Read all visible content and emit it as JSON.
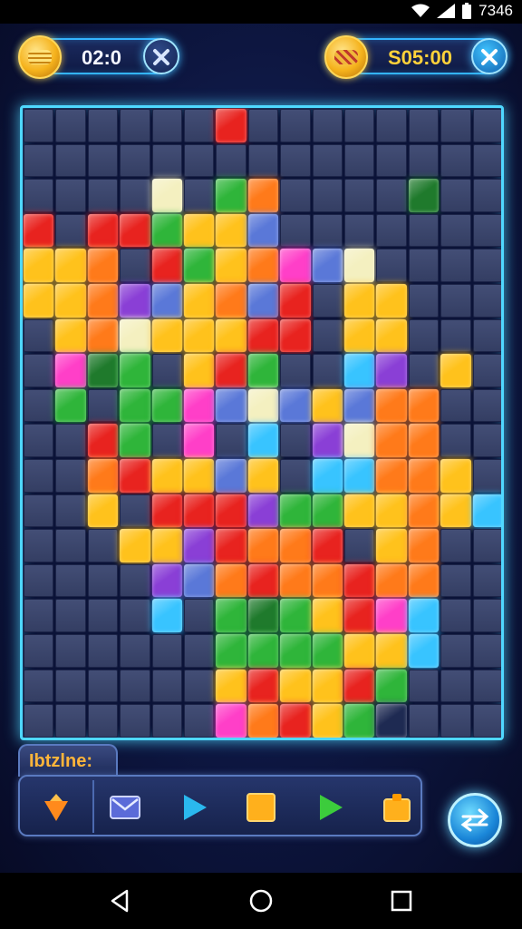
{
  "status": {
    "time": "7346",
    "icons": [
      "wifi-icon",
      "signal-icon",
      "battery-icon"
    ]
  },
  "hud": {
    "timer": "02:0",
    "score": "S05:00",
    "left_button_icon": "close-icon",
    "right_button_icon": "close-icon"
  },
  "toolbar": {
    "label": "Ibtzlne:",
    "tools": [
      "drop-icon",
      "mail-icon",
      "play-icon",
      "square-icon",
      "play-icon",
      "bag-icon"
    ]
  },
  "action_button": {
    "icon": "swap-arrows-icon"
  },
  "nav": {
    "buttons": [
      "back-icon",
      "home-icon",
      "recents-icon"
    ]
  },
  "colors": {
    "accent": "#4fd8ff",
    "score": "#ffd23a",
    "tool_label": "#ffb53a",
    "empty_piece": "#3a4468"
  }
}
